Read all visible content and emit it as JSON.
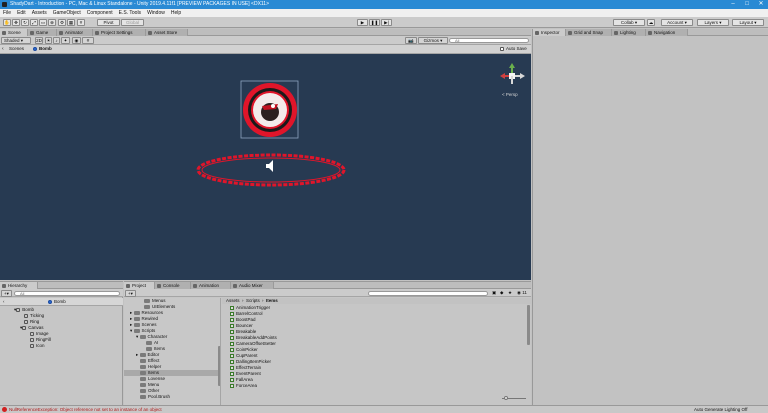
{
  "window": {
    "title": "ShadyDart - Introduction - PC, Mac & Linux Standalone - Unity 2019.4.11f1 [PREVIEW PACKAGES IN USE] <DX11>"
  },
  "menu": [
    "File",
    "Edit",
    "Assets",
    "GameObject",
    "Component",
    "E.S. Tools",
    "Window",
    "Help"
  ],
  "toolbar": {
    "pivot": "Pivot",
    "global": "Global",
    "collab": "Collab",
    "account": "Account",
    "layers": "Layers",
    "layout": "Layout"
  },
  "top_tabs": [
    "Scene",
    "Game",
    "Animator",
    "Project Settings",
    "Asset Store"
  ],
  "right_tabs": [
    "Inspector",
    "Grid and Snap",
    "Lighting",
    "Navigation"
  ],
  "scene": {
    "shading": "Shaded",
    "mode2d": "2D",
    "gizmos": "Gizmos",
    "search_placeholder": "All",
    "breadcrumb_root": "Scenes",
    "breadcrumb_item": "Bomb",
    "autosave": "Auto Save",
    "persp": "< Persp"
  },
  "hierarchy": {
    "tab": "Hierarchy",
    "search_placeholder": "All",
    "scene": "Bomb",
    "items": [
      {
        "label": "Bomb"
      },
      {
        "label": "Ticking"
      },
      {
        "label": "Ring"
      },
      {
        "label": "Canvas"
      },
      {
        "label": "Image"
      },
      {
        "label": "RingFill"
      },
      {
        "label": "Icon"
      }
    ]
  },
  "bottom_tabs": [
    "Project",
    "Console",
    "Animation",
    "Audio Mixer"
  ],
  "project": {
    "breadcrumb": [
      "Assets",
      "Scripts",
      "Items"
    ],
    "tree": [
      {
        "label": "Menus"
      },
      {
        "label": "UIElements"
      },
      {
        "label": "Resources"
      },
      {
        "label": "Rewired"
      },
      {
        "label": "Scenes"
      },
      {
        "label": "Scripts"
      },
      {
        "label": "Character"
      },
      {
        "label": "AI"
      },
      {
        "label": "Items"
      },
      {
        "label": "Editor"
      },
      {
        "label": "Effect"
      },
      {
        "label": "Helper"
      },
      {
        "label": "Items"
      },
      {
        "label": "Lovense"
      },
      {
        "label": "Menu"
      },
      {
        "label": "Other"
      },
      {
        "label": "Pool.Brush"
      }
    ],
    "files": [
      "AnimationTrigger",
      "BarrelControl",
      "BoostPad",
      "Bouncer",
      "Breakable",
      "BreakableAddPoints",
      "CameraOffsetSetter",
      "CoinPicker",
      "CupParent",
      "DallingItemPicker",
      "EffectTerrain",
      "EventParent",
      "FallArea",
      "ForceArea"
    ],
    "count": "11"
  },
  "status": {
    "error": "NullReferenceException: Object reference not set to an instance of an object",
    "right": "Auto Generate Lighting Off"
  },
  "colors": {
    "scene_bg": "#273a52",
    "title_bar": "#2a8ad4",
    "ring_red": "#e0152a"
  }
}
